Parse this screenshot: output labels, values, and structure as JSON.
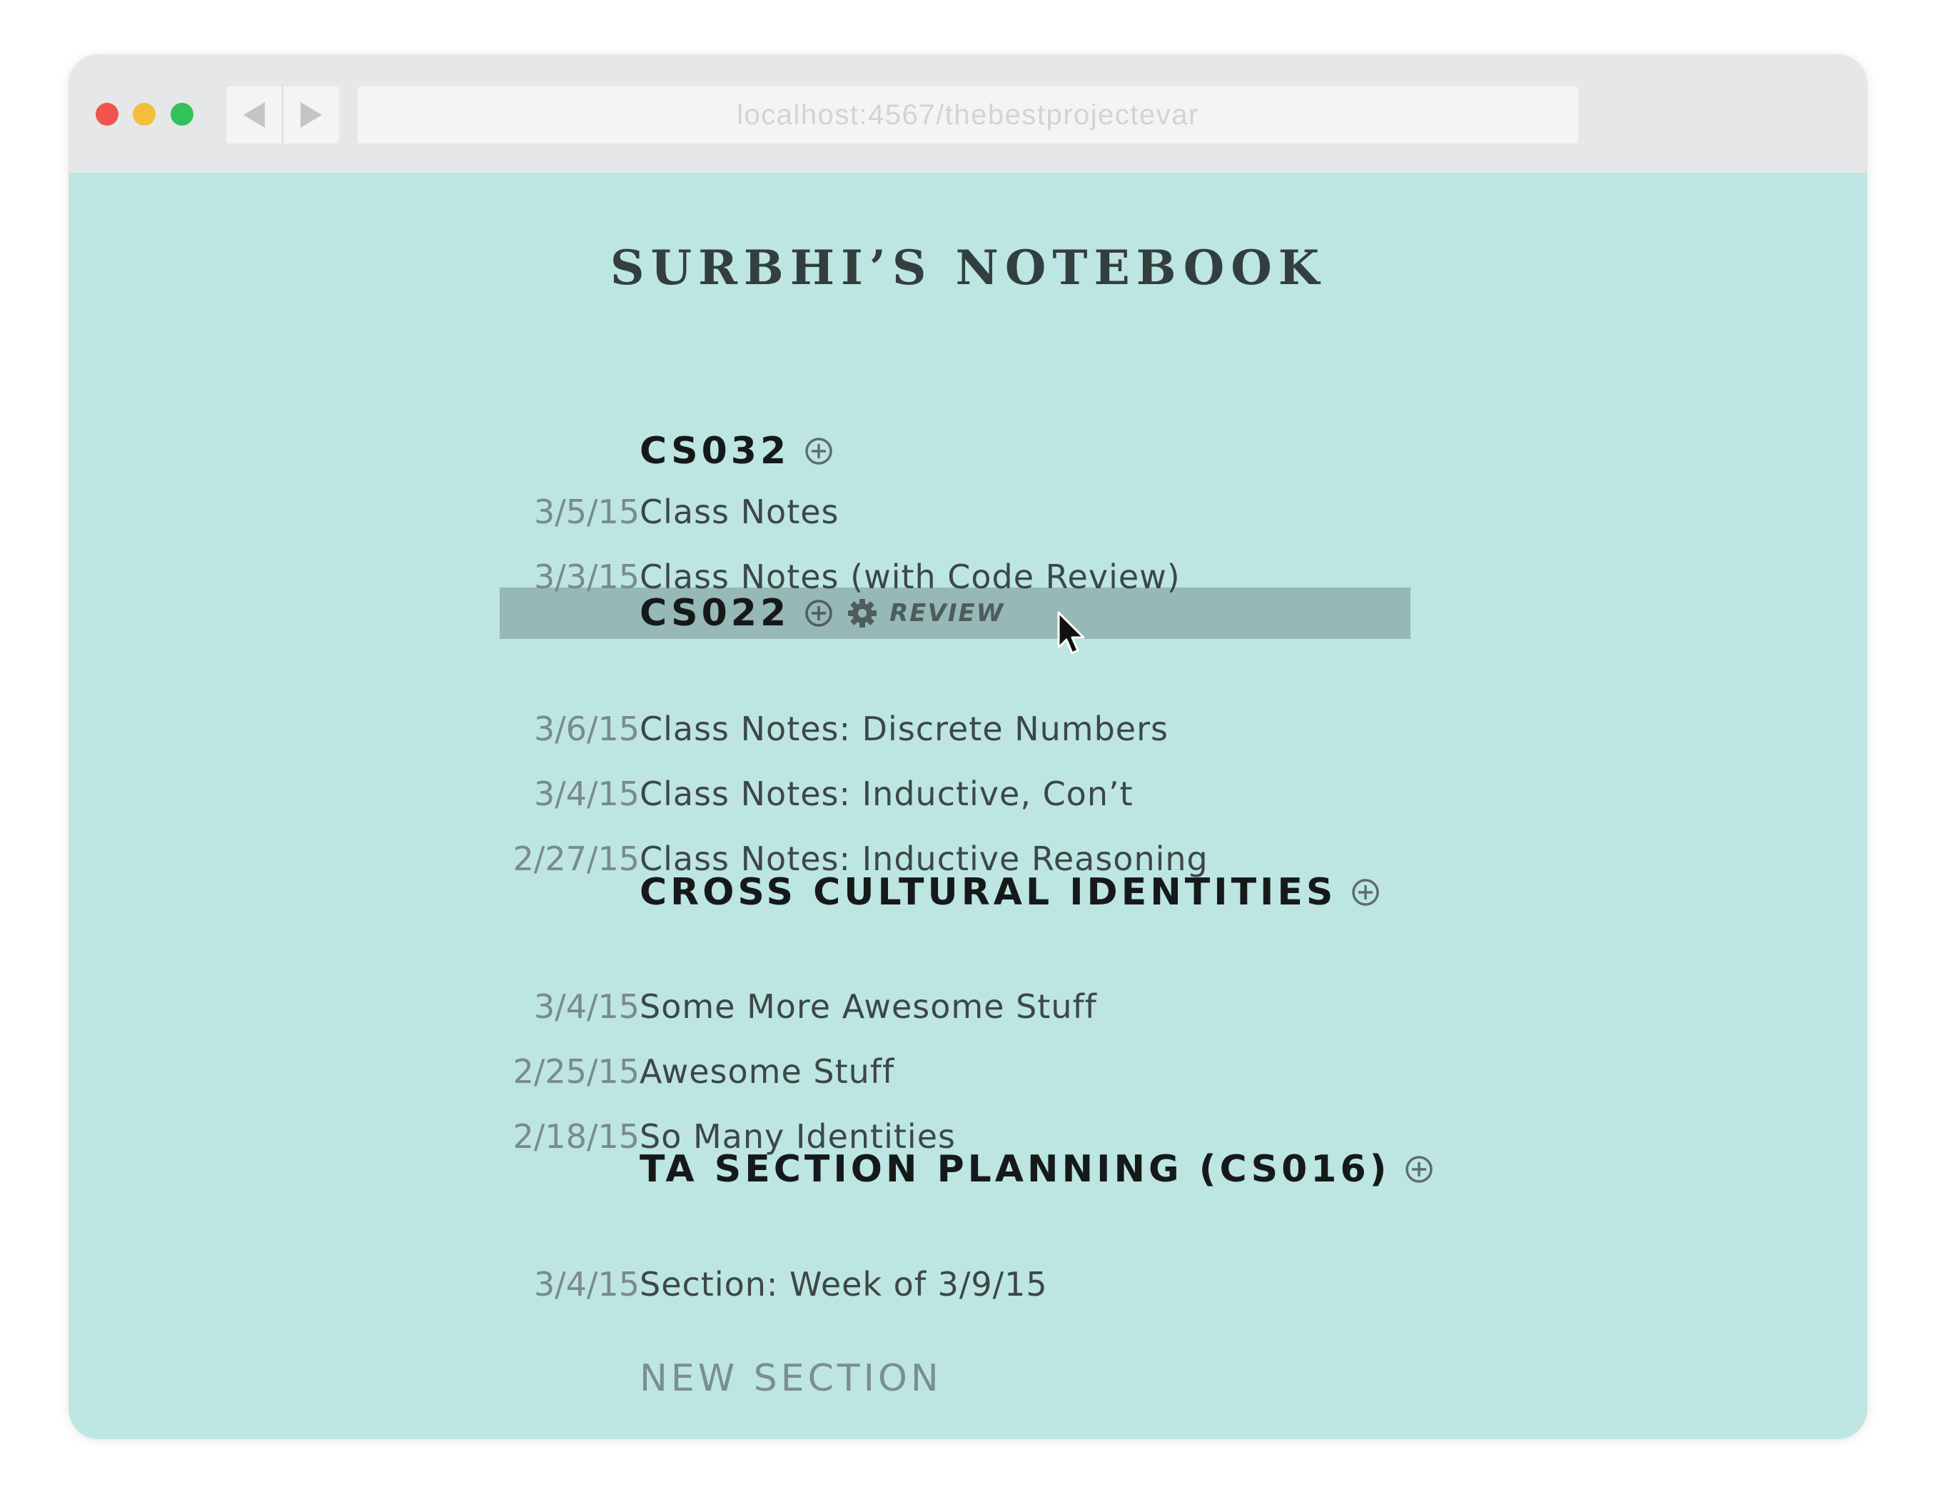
{
  "browser": {
    "url": "localhost:4567/thebestprojectevar",
    "back_icon": "back-arrow-icon",
    "forward_icon": "forward-arrow-icon",
    "traffic_lights": {
      "close": "#f0554f",
      "minimize": "#f5be3a",
      "maximize": "#32c25c"
    }
  },
  "page": {
    "title": "SURBHI’S NOTEBOOK",
    "background": "#bde6e3",
    "new_section_label": "NEW SECTION"
  },
  "sections": [
    {
      "title": "CS032",
      "entries": [
        {
          "date": "3/5/15",
          "title": "Class Notes"
        },
        {
          "date": "3/3/15",
          "title": "Class Notes (with Code Review)"
        }
      ]
    },
    {
      "title": "CS022",
      "highlighted": true,
      "review_label": "REVIEW",
      "entries": [
        {
          "date": "3/6/15",
          "title": "Class Notes: Discrete Numbers"
        },
        {
          "date": "3/4/15",
          "title": "Class Notes: Inductive, Con’t"
        },
        {
          "date": "2/27/15",
          "title": "Class Notes: Inductive Reasoning"
        }
      ]
    },
    {
      "title": "CROSS CULTURAL IDENTITIES",
      "entries": [
        {
          "date": "3/4/15",
          "title": "Some More Awesome Stuff"
        },
        {
          "date": "2/25/15",
          "title": "Awesome Stuff"
        },
        {
          "date": "2/18/15",
          "title": "So Many Identities"
        }
      ]
    },
    {
      "title": "TA SECTION PLANNING (CS016)",
      "entries": [
        {
          "date": "3/4/15",
          "title": "Section: Week of 3/9/15"
        }
      ]
    }
  ]
}
